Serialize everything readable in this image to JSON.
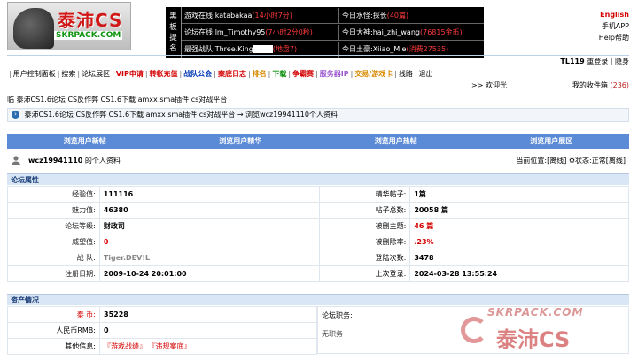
{
  "logo": {
    "title": "泰沛CS",
    "site": "SKRPACK.COM"
  },
  "infobox": {
    "side_chars": [
      "黑",
      "板",
      "提",
      "名"
    ],
    "rows": [
      {
        "left_label": "游戏在线:",
        "left_value": "katabakaa",
        "left_extra": "(14小时7分)",
        "right_label": "今日水怪:",
        "right_value": "探长",
        "right_extra": "(40篇)"
      },
      {
        "left_label": "论坛在线:",
        "left_value": "lm_Timothy95",
        "left_extra": "(7小时2分0秒)",
        "right_label": "今日大神:",
        "right_value": "hai_zhi_wang",
        "right_extra": "(76815金币)"
      },
      {
        "left_label": "最强战队:",
        "left_value": "Three.King",
        "left_extra": "(地盘7)",
        "right_label": "今日土豪:",
        "right_value": "Xiiao_Mie",
        "right_extra": "(消费27535)"
      }
    ]
  },
  "right_links": {
    "english": "English",
    "app": "手机APP",
    "help": "Help帮助"
  },
  "topbar": {
    "user": "TL119",
    "login": "重登录",
    "hide": "隐身"
  },
  "menu": [
    {
      "label": "用户控制面板",
      "color": "#000"
    },
    {
      "label": "搜索",
      "color": "#000"
    },
    {
      "label": "论坛展区",
      "color": "#000"
    },
    {
      "label": "VIP申请",
      "color": "#d40000"
    },
    {
      "label": "转帐充值",
      "color": "#d40000"
    },
    {
      "label": "战队公会",
      "color": "#0b3fb8"
    },
    {
      "label": "案底日志",
      "color": "#d40000"
    },
    {
      "label": "排名",
      "color": "#d98a00"
    },
    {
      "label": "下载",
      "color": "#008a00"
    },
    {
      "label": "争霸赛",
      "color": "#d40000"
    },
    {
      "label": "服务器IP",
      "color": "#9b59d0"
    },
    {
      "label": "交易/游戏卡",
      "color": "#d98a00"
    },
    {
      "label": "线路",
      "color": "#000"
    },
    {
      "label": "退出",
      "color": "#000"
    }
  ],
  "welcome": ">> 欢迎光",
  "favorites": {
    "label": "我的收件箱",
    "count": "(236)"
  },
  "forum_line": "临 泰沛CS1.6论坛 CS反作弊 CS1.6下载 amxx sma插件 cs对战平台",
  "breadcrumb": {
    "root": "泰沛CS1.6论坛 CS反作弊 CS1.6下载 amxx sma插件 cs对战平台",
    "sep": "→",
    "current": "浏览wcz19941110个人资料"
  },
  "tabs": [
    "浏览用户新帖",
    "浏览用户精华",
    "浏览用户热帖",
    "浏览用户展区"
  ],
  "profile_header": {
    "username": "wcz19941110",
    "suffix": "的个人资料",
    "location_label": "当前位置:",
    "location_value": "[离线]",
    "status_label": "状态:",
    "status_value": "正常[离线]"
  },
  "forum_attrs": {
    "title": "论坛属性",
    "rows": [
      {
        "l1": "经验值:",
        "v1": "111116",
        "l2": "精华帖子:",
        "v2": "1篇"
      },
      {
        "l1": "魅力值:",
        "v1": "46380",
        "l2": "帖子总数:",
        "v2": "20058 篇"
      },
      {
        "l1": "论坛等级:",
        "v1": "财政司",
        "l2": "被删主题:",
        "v2": "46 篇"
      },
      {
        "l1": "威望值:",
        "v1": "0",
        "l2": "被删除率:",
        "v2": ".23%"
      },
      {
        "l1": "战 队:",
        "v1": "Tiger.DEV!L",
        "l2": "登陆次数:",
        "v2": "3478"
      },
      {
        "l1": "注册日期:",
        "v1": "2009-10-24 20:01:00",
        "l2": "上次登录:",
        "v2": "2024-03-28 13:55:24"
      }
    ]
  },
  "assets": {
    "title": "资产情况",
    "coin_label": "泰 币:",
    "coin_value": "35228",
    "rmb_label": "人民币RMB:",
    "rmb_value": "0",
    "other_label": "其他信息:",
    "other_link1": "『游戏战绩』",
    "other_link2": "『违规案底』",
    "post_label": "论坛职务:",
    "post_value": "无职务"
  },
  "watermark": {
    "line1": "SKRPACK.COM",
    "line2": "泰沛CS"
  },
  "colors": {
    "tab_bg": "#5b8ad6",
    "section_bg": "#d9e6f5",
    "accent_red": "#d40000"
  }
}
